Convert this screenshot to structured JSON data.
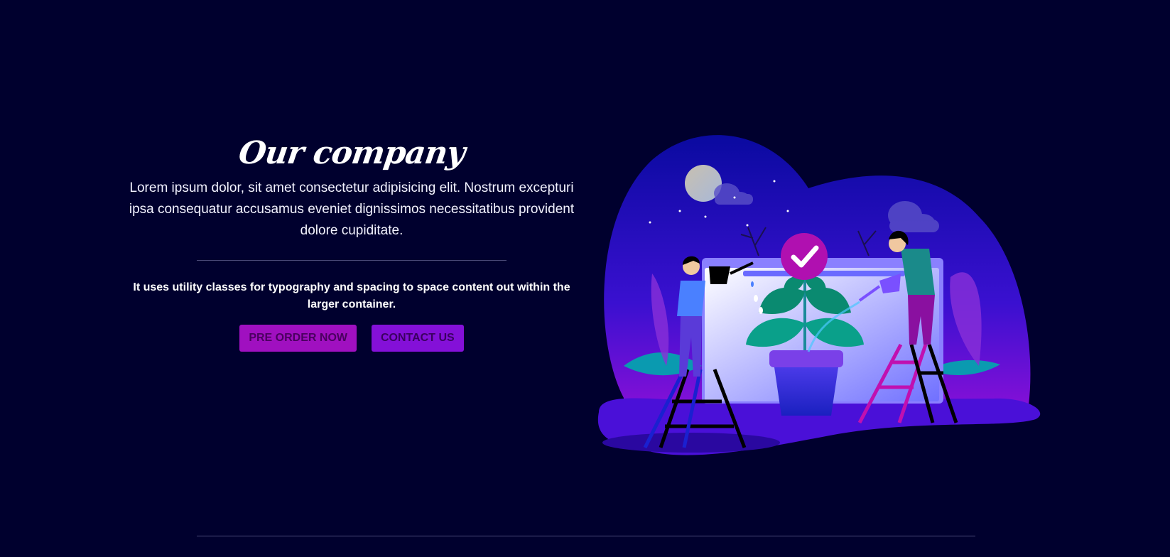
{
  "hero": {
    "title": "Our company",
    "lead": "Lorem ipsum dolor, sit amet consectetur adipisicing elit. Nostrum excepturi ipsa consequatur accusamus eveniet dignissimos necessitatibus provident dolore cupiditate.",
    "subtext": "It uses utility classes for typography and spacing to space content out within the larger container.",
    "primary_button": "PRE ORDER NOW",
    "secondary_button": "CONTACT US"
  },
  "illustration": {
    "icon": "check-icon",
    "subject": "two people watering a potted plant"
  },
  "colors": {
    "background": "#00002e",
    "primary": "#a010c0",
    "secondary": "#8410d8"
  }
}
